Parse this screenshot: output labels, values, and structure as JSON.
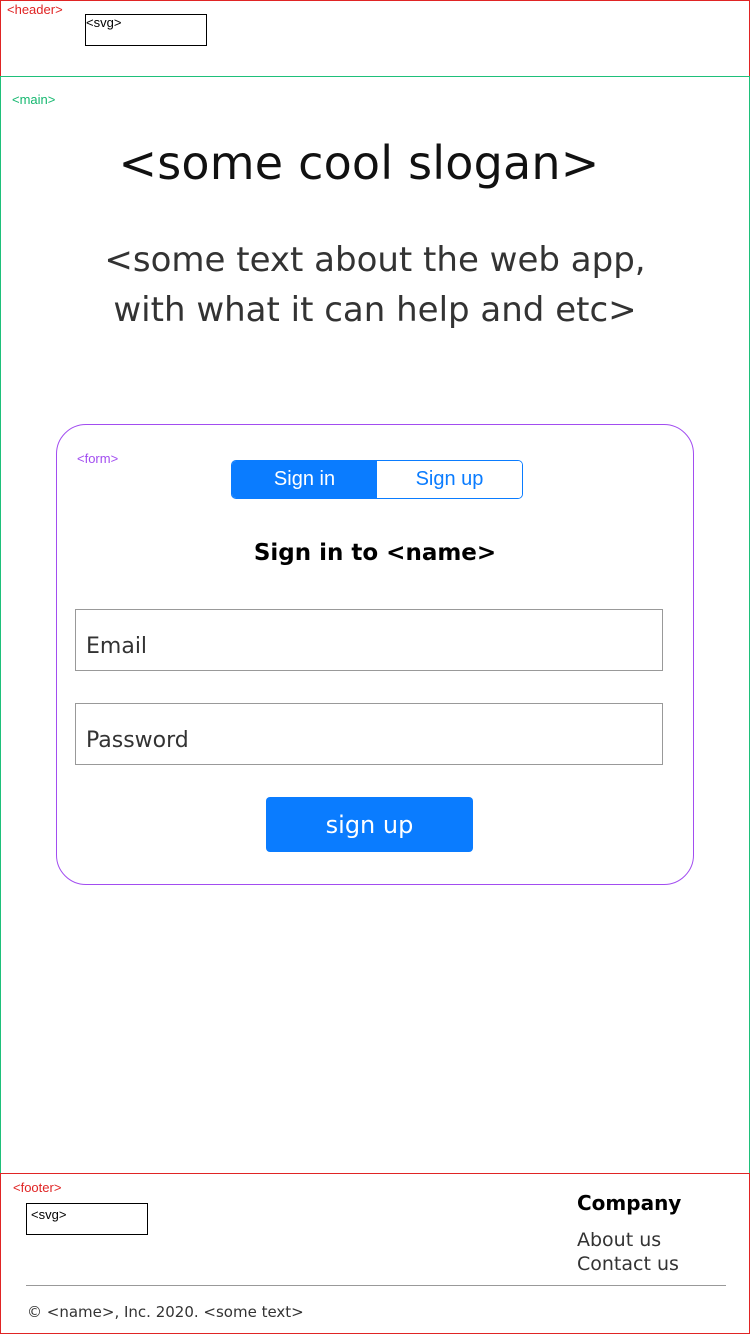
{
  "header": {
    "tag": "<header>",
    "logo_tag": "<svg>"
  },
  "main": {
    "tag": "<main>",
    "slogan": "<some cool slogan>",
    "about_line1": "<some text about the web app,",
    "about_line2": "with what it can help and etc>"
  },
  "form": {
    "tag": "<form>",
    "tabs": [
      {
        "label": "Sign in",
        "active": true
      },
      {
        "label": "Sign up",
        "active": false
      }
    ],
    "title": "Sign in to <name>",
    "email_placeholder": "Email",
    "password_placeholder": "Password",
    "submit_label": "sign up"
  },
  "footer": {
    "tag": "<footer>",
    "logo_tag": "<svg>",
    "company_heading": "Company",
    "links": [
      "About us",
      "Contact us"
    ],
    "copyright": "© <name>, Inc. 2020. <some text>"
  },
  "colors": {
    "accent": "#0a7cff",
    "header_border": "#e02424",
    "main_border": "#1ec07a",
    "form_border": "#a24df0"
  }
}
